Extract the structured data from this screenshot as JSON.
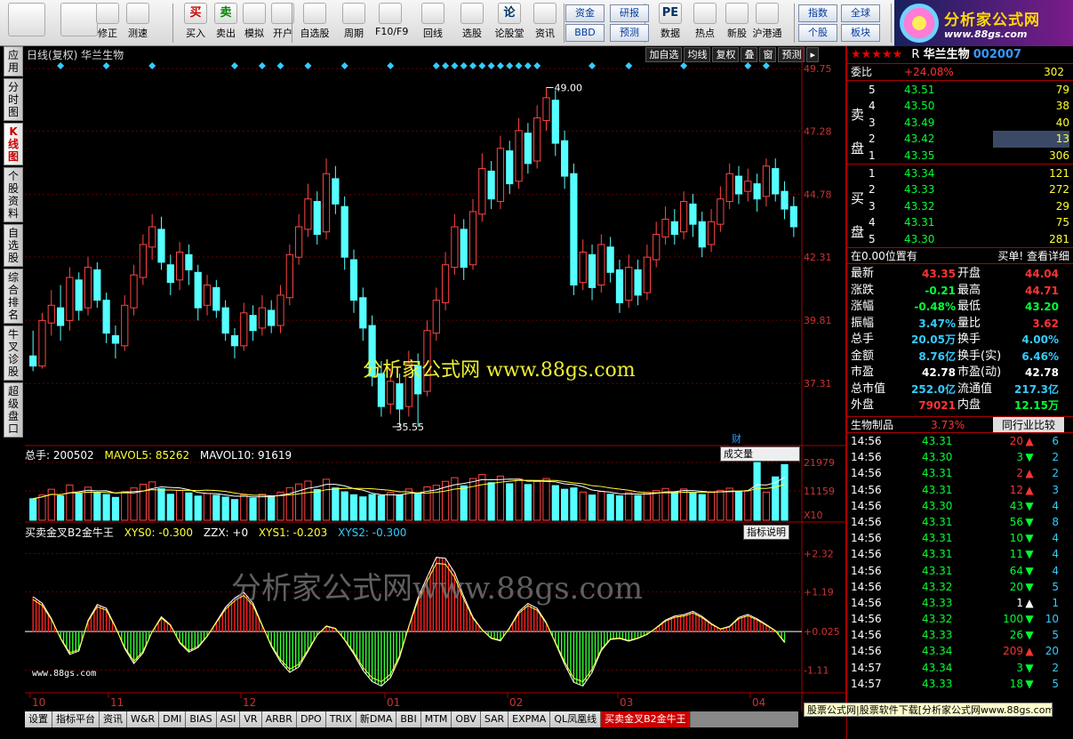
{
  "toolbar": {
    "big_buttons": [
      {
        "label": "",
        "icon": "grid-icon"
      },
      {
        "label": "",
        "icon": "back-arrow-icon"
      },
      {
        "label": "修正",
        "icon": "up-down-arrow-icon"
      },
      {
        "label": "测速",
        "icon": "clock-icon"
      },
      {
        "label": "买入",
        "icon": "buy-icon",
        "glyph": "买"
      },
      {
        "label": "卖出",
        "icon": "sell-icon",
        "glyph": "卖"
      },
      {
        "label": "模拟",
        "icon": "hammer-icon"
      },
      {
        "label": "开户",
        "icon": "lock-icon"
      },
      {
        "label": "自选股",
        "icon": "star-icon"
      },
      {
        "label": "周期",
        "icon": "clock-icon"
      },
      {
        "label": "F10/F9",
        "icon": "info-icon"
      },
      {
        "label": "回线",
        "icon": "pencil-icon"
      },
      {
        "label": "选股",
        "icon": "screen-icon"
      },
      {
        "label": "论股堂",
        "icon": "forum-icon",
        "glyph": "论"
      },
      {
        "label": "资讯",
        "icon": "news-icon"
      },
      {
        "label": "数据",
        "icon": "pe-icon",
        "glyph": "PE"
      },
      {
        "label": "热点",
        "icon": "fire-icon"
      },
      {
        "label": "新股",
        "icon": "doc-icon"
      },
      {
        "label": "沪港通",
        "icon": "sse-hke-icon"
      }
    ],
    "small_buttons": [
      "资金",
      "BBD",
      "研报",
      "预测",
      "指数",
      "个股",
      "全球",
      "板块"
    ]
  },
  "logo": {
    "title": "分析家公式网",
    "url": "www.88gs.com"
  },
  "left_tabs": [
    "应用",
    "分时图",
    "K线图",
    "个股资料",
    "自选股",
    "综合排名",
    "牛叉诊股",
    "超级盘口"
  ],
  "chart": {
    "title": "日线(复权)  华兰生物",
    "buttons": [
      "加自选",
      "均线",
      "复权",
      "叠",
      "窗",
      "预测"
    ],
    "price_axis": [
      "49.75",
      "47.28",
      "44.78",
      "42.31",
      "39.81",
      "37.31"
    ],
    "high_mark": "49.00",
    "low_mark": "35.55",
    "volume_label": {
      "total": "总手: 200502",
      "mavol5": "MAVOL5: 85262",
      "mavol10": "MAVOL10: 91619"
    },
    "volume_axis": [
      "21979",
      "11159",
      "X10"
    ],
    "volume_selector": "成交量",
    "finance_badge": "财",
    "indicator_label": {
      "name": "买卖金叉B2金牛王",
      "xys0": "XYS0: -0.300",
      "zzx": "ZZX: +0",
      "xys1": "XYS1: -0.203",
      "xys2": "XYS2: -0.300"
    },
    "indicator_axis": [
      "+2.32",
      "+1.19",
      "+0.025",
      "-1.11"
    ],
    "indicator_btn": "指标说明",
    "watermark_main": "分析家公式网  www.88gs.com",
    "watermark_ind": "分析家公式网www.88gs.com",
    "watermark_small": "www.88gs.com",
    "date_axis": [
      "10",
      "11",
      "12",
      "01",
      "02",
      "03",
      "04"
    ]
  },
  "chart_data": {
    "type": "candlestick",
    "ylim": [
      35.0,
      50.0
    ],
    "candles": [
      [
        38.4,
        38.0,
        39.4,
        37.8
      ],
      [
        38.0,
        39.8,
        40.1,
        37.9
      ],
      [
        39.7,
        40.4,
        41.0,
        39.2
      ],
      [
        40.3,
        39.6,
        41.2,
        39.0
      ],
      [
        39.8,
        41.5,
        41.9,
        39.4
      ],
      [
        41.4,
        40.2,
        41.7,
        39.8
      ],
      [
        40.3,
        41.9,
        42.3,
        40.0
      ],
      [
        41.8,
        40.6,
        42.1,
        40.3
      ],
      [
        40.6,
        39.3,
        40.9,
        38.9
      ],
      [
        39.2,
        38.9,
        39.6,
        38.3
      ],
      [
        38.8,
        40.4,
        40.8,
        38.6
      ],
      [
        40.3,
        41.6,
        42.0,
        40.0
      ],
      [
        41.5,
        42.8,
        43.2,
        41.2
      ],
      [
        42.7,
        43.5,
        44.0,
        42.2
      ],
      [
        43.4,
        42.1,
        43.9,
        41.8
      ],
      [
        42.0,
        41.3,
        42.4,
        40.8
      ],
      [
        41.4,
        42.5,
        42.9,
        41.0
      ],
      [
        42.4,
        41.8,
        42.8,
        41.2
      ],
      [
        41.7,
        40.3,
        42.0,
        39.8
      ],
      [
        40.4,
        41.2,
        41.6,
        40.0
      ],
      [
        41.1,
        40.2,
        41.4,
        39.9
      ],
      [
        40.3,
        39.3,
        40.6,
        39.0
      ],
      [
        39.2,
        38.8,
        39.5,
        38.3
      ],
      [
        38.8,
        40.1,
        40.5,
        38.6
      ],
      [
        40.0,
        39.4,
        40.4,
        39.0
      ],
      [
        39.5,
        40.3,
        40.8,
        39.2
      ],
      [
        40.2,
        39.6,
        40.6,
        39.3
      ],
      [
        39.6,
        40.8,
        41.2,
        39.3
      ],
      [
        40.7,
        42.4,
        42.8,
        40.4
      ],
      [
        42.3,
        43.5,
        44.0,
        42.0
      ],
      [
        43.4,
        44.6,
        45.2,
        43.1
      ],
      [
        44.5,
        43.2,
        44.9,
        42.8
      ],
      [
        43.3,
        45.6,
        46.2,
        43.0
      ],
      [
        45.4,
        44.4,
        45.9,
        44.0
      ],
      [
        44.3,
        42.3,
        44.7,
        41.8
      ],
      [
        42.2,
        40.6,
        42.6,
        40.1
      ],
      [
        40.7,
        39.5,
        41.1,
        39.0
      ],
      [
        39.6,
        37.6,
        40.0,
        37.2
      ],
      [
        37.7,
        36.4,
        38.2,
        36.0
      ],
      [
        36.5,
        37.4,
        37.9,
        36.1
      ],
      [
        37.3,
        36.3,
        37.7,
        35.6
      ],
      [
        36.4,
        38.1,
        38.6,
        36.0
      ],
      [
        38.0,
        36.9,
        38.5,
        35.6
      ],
      [
        37.0,
        39.4,
        39.8,
        36.8
      ],
      [
        39.3,
        40.6,
        41.1,
        39.0
      ],
      [
        40.5,
        42.0,
        42.5,
        40.2
      ],
      [
        41.9,
        43.5,
        44.0,
        41.6
      ],
      [
        43.4,
        41.9,
        43.8,
        41.4
      ],
      [
        42.0,
        44.1,
        44.6,
        41.8
      ],
      [
        44.0,
        45.8,
        46.4,
        43.7
      ],
      [
        45.7,
        44.6,
        46.1,
        44.2
      ],
      [
        44.5,
        46.6,
        47.1,
        44.2
      ],
      [
        46.5,
        45.2,
        46.9,
        44.8
      ],
      [
        45.3,
        47.3,
        47.8,
        45.0
      ],
      [
        47.2,
        46.0,
        47.6,
        45.6
      ],
      [
        46.1,
        47.8,
        48.3,
        45.8
      ],
      [
        47.7,
        48.6,
        49.0,
        47.3
      ],
      [
        48.5,
        46.8,
        48.9,
        46.3
      ],
      [
        46.9,
        45.5,
        47.3,
        45.0
      ],
      [
        45.6,
        41.2,
        46.0,
        40.8
      ],
      [
        41.3,
        42.5,
        43.0,
        41.0
      ],
      [
        42.4,
        41.1,
        42.8,
        40.6
      ],
      [
        41.2,
        42.8,
        43.2,
        40.9
      ],
      [
        42.7,
        41.7,
        43.1,
        41.3
      ],
      [
        41.8,
        40.5,
        42.2,
        40.1
      ],
      [
        40.6,
        41.9,
        42.4,
        40.3
      ],
      [
        41.8,
        40.8,
        42.2,
        40.4
      ],
      [
        40.9,
        42.3,
        42.8,
        40.6
      ],
      [
        42.2,
        43.2,
        43.7,
        41.9
      ],
      [
        43.1,
        43.8,
        44.3,
        42.8
      ],
      [
        43.7,
        43.2,
        44.2,
        42.8
      ],
      [
        43.3,
        44.5,
        44.9,
        43.0
      ],
      [
        44.4,
        43.6,
        44.8,
        43.1
      ],
      [
        43.7,
        42.7,
        44.1,
        42.3
      ],
      [
        42.8,
        43.7,
        44.2,
        42.5
      ],
      [
        43.6,
        44.6,
        45.1,
        43.3
      ],
      [
        44.5,
        45.6,
        46.0,
        44.2
      ],
      [
        45.5,
        44.8,
        45.9,
        44.4
      ],
      [
        44.9,
        45.3,
        45.8,
        44.5
      ],
      [
        45.2,
        44.6,
        45.6,
        44.1
      ],
      [
        44.7,
        45.9,
        46.2,
        44.3
      ],
      [
        45.8,
        44.8,
        46.2,
        44.5
      ],
      [
        44.9,
        44.2,
        45.3,
        43.8
      ],
      [
        44.3,
        43.5,
        44.7,
        43.1
      ]
    ],
    "volume_ylim": [
      0,
      22000
    ],
    "volume": [
      8200,
      9600,
      11800,
      9300,
      13400,
      10100,
      12600,
      10400,
      9800,
      8700,
      10900,
      12300,
      13700,
      14600,
      12000,
      9900,
      11300,
      10400,
      9200,
      10200,
      9500,
      8800,
      7900,
      9600,
      8400,
      9900,
      9100,
      10700,
      12400,
      13800,
      14900,
      11700,
      15600,
      12300,
      10800,
      9700,
      8900,
      9800,
      9400,
      10600,
      9500,
      11900,
      10400,
      12700,
      13300,
      14800,
      16200,
      13100,
      15900,
      17400,
      14300,
      16800,
      13900,
      15700,
      13600,
      14700,
      15900,
      13200,
      11800,
      12300,
      10700,
      9600,
      10900,
      9900,
      9300,
      10500,
      9400,
      10600,
      11300,
      12100,
      10800,
      11900,
      10300,
      9800,
      10600,
      11400,
      12200,
      10900,
      11300,
      21979,
      10700,
      16500,
      21200
    ],
    "indicator_ylim": [
      -1.7,
      2.7
    ],
    "indicator": [
      1.05,
      0.86,
      0.41,
      -0.18,
      -0.65,
      -0.55,
      0.35,
      0.82,
      0.71,
      0.16,
      -0.48,
      -0.92,
      -0.61,
      0.02,
      0.46,
      0.22,
      -0.31,
      -0.58,
      -0.45,
      -0.12,
      0.31,
      0.74,
      1.01,
      1.18,
      0.86,
      0.22,
      -0.41,
      -0.87,
      -1.18,
      -1.02,
      -0.56,
      -0.08,
      0.19,
      0.12,
      -0.23,
      -0.64,
      -1.12,
      -1.45,
      -1.58,
      -1.34,
      -0.74,
      0.18,
      1.02,
      1.63,
      2.21,
      2.18,
      1.76,
      1.06,
      0.45,
      0.08,
      -0.18,
      -0.25,
      0.14,
      0.61,
      0.85,
      0.71,
      0.29,
      -0.32,
      -0.94,
      -1.47,
      -1.58,
      -1.18,
      -0.54,
      -0.21,
      -0.18,
      -0.26,
      -0.18,
      -0.06,
      0.14,
      0.36,
      0.48,
      0.52,
      0.62,
      0.47,
      0.26,
      0.1,
      0.18,
      0.44,
      0.53,
      0.4,
      0.23,
      0.05,
      -0.3
    ]
  },
  "quote": {
    "stars": "★★★★★",
    "prefix": "R",
    "name": "华兰生物",
    "code": "002007",
    "weibi_label": "委比",
    "weibi": "+24.08%",
    "weibi_vol": "302",
    "sell_label": "卖盘",
    "buy_label": "买盘",
    "sell": [
      {
        "lv": "5",
        "price": "43.51",
        "vol": "79"
      },
      {
        "lv": "4",
        "price": "43.50",
        "vol": "38"
      },
      {
        "lv": "3",
        "price": "43.49",
        "vol": "40"
      },
      {
        "lv": "2",
        "price": "43.42",
        "vol": "13"
      },
      {
        "lv": "1",
        "price": "43.35",
        "vol": "306"
      }
    ],
    "buy": [
      {
        "lv": "1",
        "price": "43.34",
        "vol": "121"
      },
      {
        "lv": "2",
        "price": "43.33",
        "vol": "272"
      },
      {
        "lv": "3",
        "price": "43.32",
        "vol": "29"
      },
      {
        "lv": "4",
        "price": "43.31",
        "vol": "75"
      },
      {
        "lv": "5",
        "price": "43.30",
        "vol": "281"
      }
    ],
    "pos_label": "在0.00位置有",
    "detail_link": "买单! 查看详细",
    "stats": [
      {
        "l1": "最新",
        "v1": "43.35",
        "c1": "up",
        "l2": "开盘",
        "v2": "44.04",
        "c2": "up"
      },
      {
        "l1": "涨跌",
        "v1": "-0.21",
        "c1": "dn",
        "l2": "最高",
        "v2": "44.71",
        "c2": "up"
      },
      {
        "l1": "涨幅",
        "v1": "-0.48%",
        "c1": "dn",
        "l2": "最低",
        "v2": "43.20",
        "c2": "dn"
      },
      {
        "l1": "振幅",
        "v1": "3.47%",
        "c1": "cy",
        "l2": "量比",
        "v2": "3.62",
        "c2": "up"
      },
      {
        "l1": "总手",
        "v1": "20.05万",
        "c1": "cy",
        "l2": "换手",
        "v2": "4.00%",
        "c2": "cy"
      },
      {
        "l1": "金额",
        "v1": "8.76亿",
        "c1": "cy",
        "l2": "换手(实)",
        "v2": "6.46%",
        "c2": "cy"
      },
      {
        "l1": "市盈",
        "v1": "42.78",
        "c1": "wh",
        "l2": "市盈(动)",
        "v2": "42.78",
        "c2": "wh"
      },
      {
        "l1": "总市值",
        "v1": "252.0亿",
        "c1": "cy",
        "l2": "流通值",
        "v2": "217.3亿",
        "c2": "cy"
      },
      {
        "l1": "外盘",
        "v1": "79021",
        "c1": "up",
        "l2": "内盘",
        "v2": "12.15万",
        "c2": "dn"
      }
    ],
    "sector_name": "生物制品",
    "sector_pct": "3.73%",
    "peer_btn": "同行业比较",
    "ticks": [
      {
        "t": "14:56",
        "p": "43.31",
        "v": "20",
        "d": "up",
        "n": "6"
      },
      {
        "t": "14:56",
        "p": "43.30",
        "v": "3",
        "d": "dn",
        "n": "2"
      },
      {
        "t": "14:56",
        "p": "43.31",
        "v": "2",
        "d": "up",
        "n": "2"
      },
      {
        "t": "14:56",
        "p": "43.31",
        "v": "12",
        "d": "up",
        "n": "3"
      },
      {
        "t": "14:56",
        "p": "43.30",
        "v": "43",
        "d": "dn",
        "n": "4"
      },
      {
        "t": "14:56",
        "p": "43.31",
        "v": "56",
        "d": "dn",
        "n": "8"
      },
      {
        "t": "14:56",
        "p": "43.31",
        "v": "10",
        "d": "dn",
        "n": "4"
      },
      {
        "t": "14:56",
        "p": "43.31",
        "v": "11",
        "d": "dn",
        "n": "4"
      },
      {
        "t": "14:56",
        "p": "43.31",
        "v": "64",
        "d": "dn",
        "n": "4"
      },
      {
        "t": "14:56",
        "p": "43.32",
        "v": "20",
        "d": "dn",
        "n": "5"
      },
      {
        "t": "14:56",
        "p": "43.33",
        "v": "1",
        "d": "wh",
        "n": "1"
      },
      {
        "t": "14:56",
        "p": "43.32",
        "v": "100",
        "d": "dn",
        "n": "10"
      },
      {
        "t": "14:56",
        "p": "43.33",
        "v": "26",
        "d": "dn",
        "n": "5"
      },
      {
        "t": "14:56",
        "p": "43.34",
        "v": "209",
        "d": "up",
        "n": "20"
      },
      {
        "t": "14:57",
        "p": "43.34",
        "v": "3",
        "d": "dn",
        "n": "2"
      },
      {
        "t": "14:57",
        "p": "43.33",
        "v": "18",
        "d": "dn",
        "n": "5"
      }
    ]
  },
  "bottom_tabs": [
    "设置",
    "指标平台",
    "资讯",
    "W&R",
    "DMI",
    "BIAS",
    "ASI",
    "VR",
    "ARBR",
    "DPO",
    "TRIX",
    "新DMA",
    "BBI",
    "MTM",
    "OBV",
    "SAR",
    "EXPMA",
    "QL凤凰线",
    "买卖金叉B2金牛王"
  ],
  "status_text": "股票公式网|股票软件下载[分析家公式网www.88gs.com]"
}
